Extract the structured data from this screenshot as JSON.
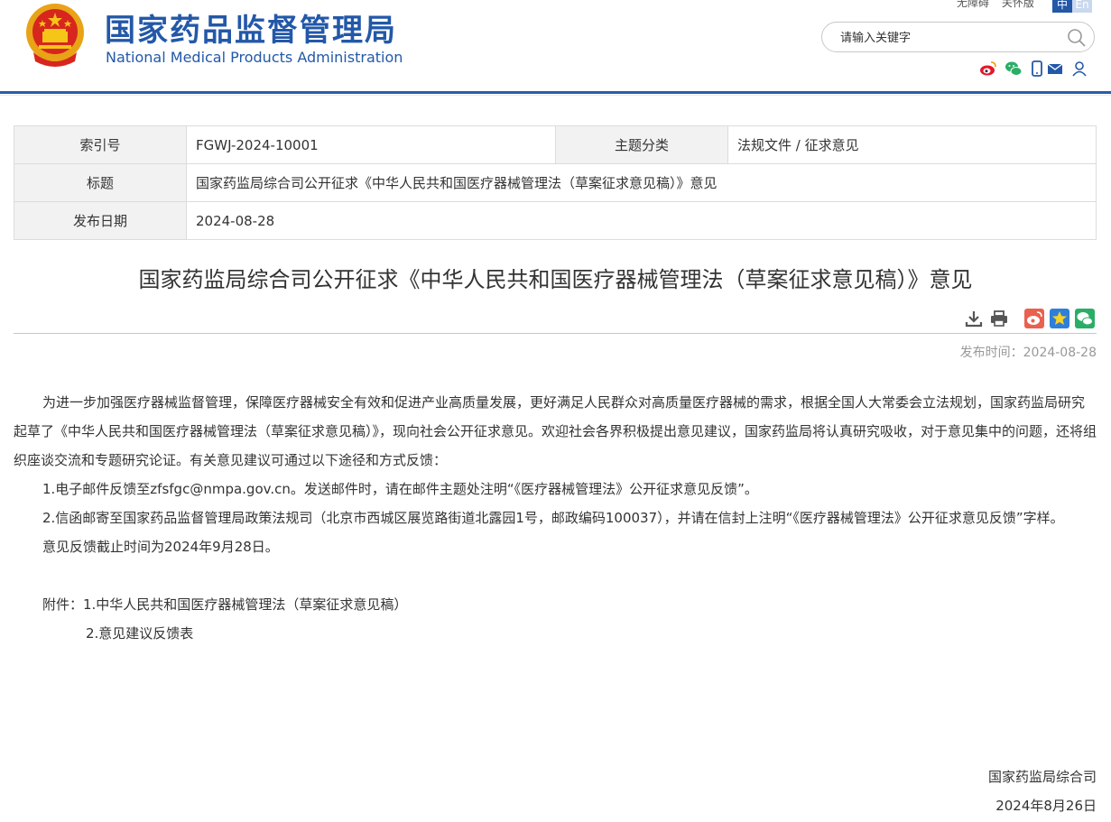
{
  "header": {
    "site_name_cn": "国家药品监督管理局",
    "site_name_en": "National Medical Products Administration",
    "links": [
      "无障碍",
      "关怀版"
    ],
    "lang_zh": "中",
    "lang_en": "En",
    "search_placeholder": "请输入关键字",
    "brand_color": "#2358a8",
    "icons": [
      "weibo-icon",
      "wechat-icon",
      "mobile-icon",
      "mail-icon",
      "user-icon"
    ]
  },
  "info_table": {
    "index_label": "索引号",
    "index_value": "FGWJ-2024-10001",
    "category_label": "主题分类",
    "category_value": "法规文件 / 征求意见",
    "title_label": "标题",
    "title_value": "国家药监局综合司公开征求《中华人民共和国医疗器械管理法（草案征求意见稿）》意见",
    "date_label": "发布日期",
    "date_value": "2024-08-28"
  },
  "article": {
    "title": "国家药监局综合司公开征求《中华人民共和国医疗器械管理法（草案征求意见稿）》意见",
    "publish_time": "发布时间：2024-08-28",
    "tool_icons": [
      "download-icon",
      "print-icon",
      "weibo-share-icon",
      "favorite-star-icon",
      "wechat-share-icon"
    ],
    "paragraphs": [
      "为进一步加强医疗器械监督管理，保障医疗器械安全有效和促进产业高质量发展，更好满足人民群众对高质量医疗器械的需求，根据全国人大常委会立法规划，国家药监局研究起草了《中华人民共和国医疗器械管理法（草案征求意见稿）》，现向社会公开征求意见。欢迎社会各界积极提出意见建议，国家药监局将认真研究吸收，对于意见集中的问题，还将组织座谈交流和专题研究论证。有关意见建议可通过以下途径和方式反馈：",
      "1.电子邮件反馈至zfsfgc@nmpa.gov.cn。发送邮件时，请在邮件主题处注明“《医疗器械管理法》公开征求意见反馈”。",
      "2.信函邮寄至国家药品监督管理局政策法规司（北京市西城区展览路街道北露园1号，邮政编码100037），并请在信封上注明“《医疗器械管理法》公开征求意见反馈”字样。",
      "意见反馈截止时间为2024年9月28日。"
    ],
    "attachment_1": "附件：1.中华人民共和国医疗器械管理法（草案征求意见稿）",
    "attachment_2": "2.意见建议反馈表",
    "signature_org": "国家药监局综合司",
    "signature_date": "2024年8月26日"
  }
}
